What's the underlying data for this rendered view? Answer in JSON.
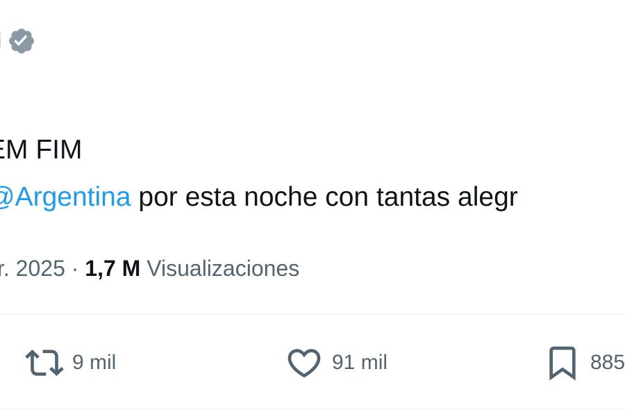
{
  "author": {
    "name_visible": "i",
    "verified_icon": "verified-badge-icon",
    "verified_color": "#8b98a5"
  },
  "tweet": {
    "line1": "EM FIM",
    "mention": "@Argentina",
    "line2_rest": " por esta noche con tantas alegr",
    "mention_color": "#1d9bf0"
  },
  "meta": {
    "date_partial": "r. 2025",
    "separator": " · ",
    "views_count": "1,7 M",
    "views_label": "Visualizaciones"
  },
  "actions": {
    "retweet": {
      "icon": "retweet-icon",
      "count": "9 mil"
    },
    "like": {
      "icon": "heart-icon",
      "count": "91 mil"
    },
    "bookmark": {
      "icon": "bookmark-icon",
      "count": "885"
    }
  }
}
